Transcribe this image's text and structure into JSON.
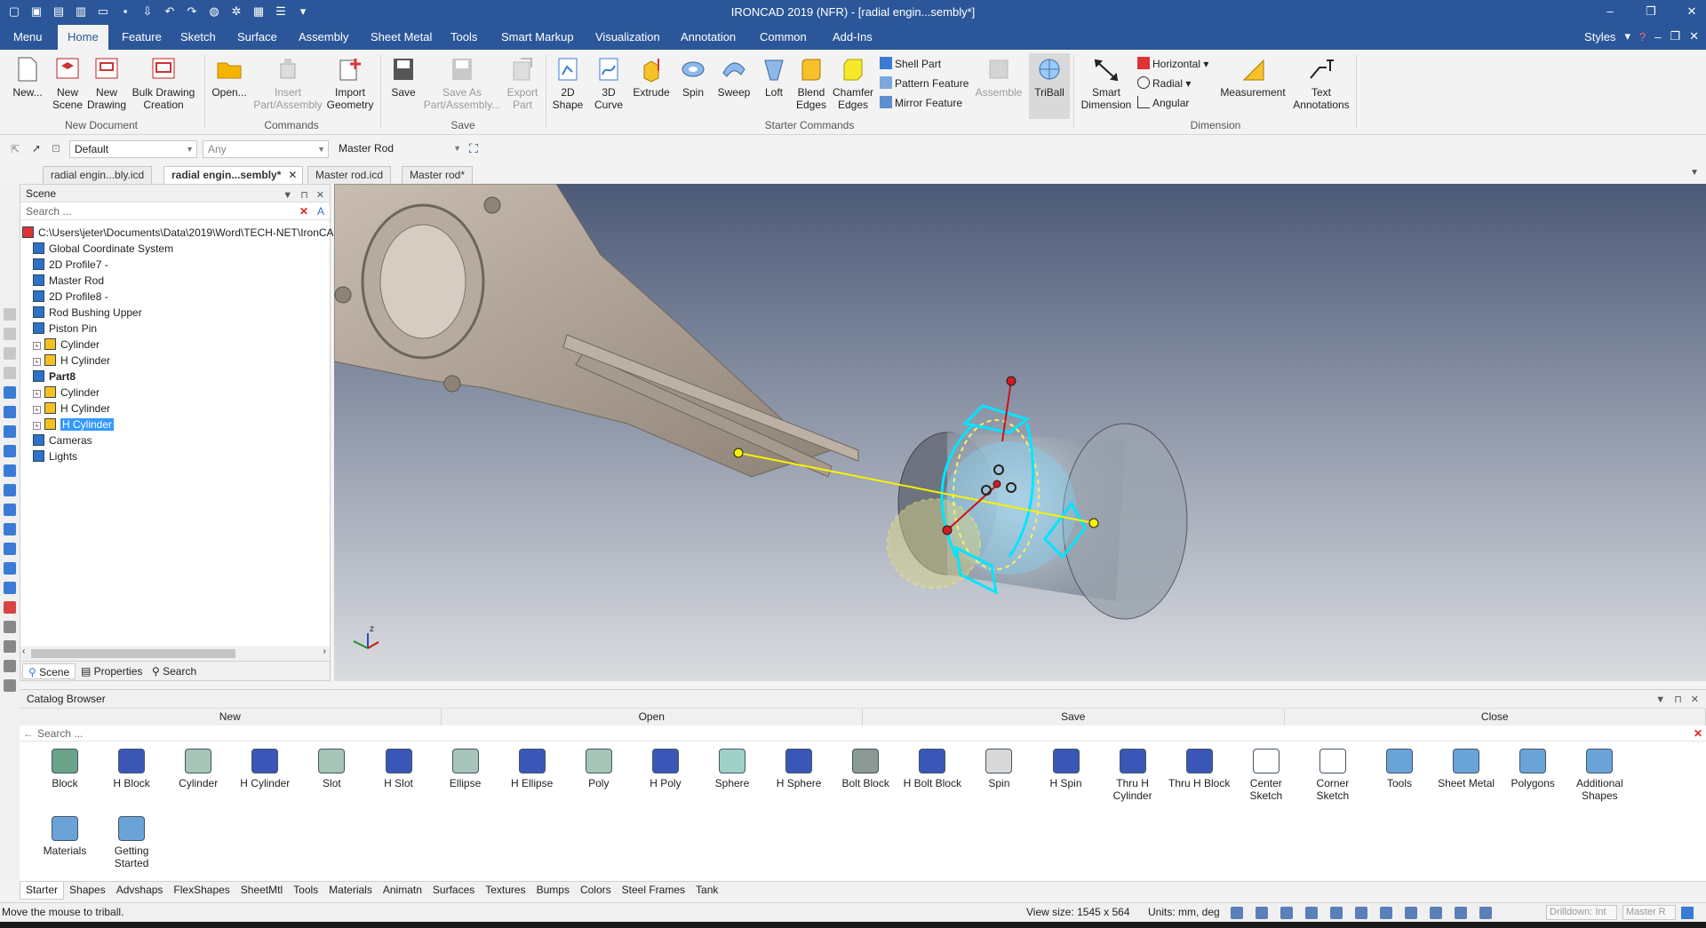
{
  "app": {
    "window_title": "IRONCAD 2019 (NFR) - [radial engin...sembly*]"
  },
  "menu_tabs": [
    "Menu",
    "Home",
    "Feature",
    "Sketch",
    "Surface",
    "Assembly",
    "Sheet Metal",
    "Tools",
    "Smart Markup",
    "Visualization",
    "Annotation",
    "Common",
    "Add-Ins"
  ],
  "styles_label": "Styles",
  "ribbon": {
    "new_document": {
      "group_label": "New Document",
      "buttons": [
        "New...",
        "New Scene",
        "New Drawing",
        "Bulk Drawing Creation"
      ]
    },
    "commands": {
      "group_label": "Commands",
      "buttons": [
        "Open...",
        "Insert Part/Assembly",
        "Import Geometry"
      ]
    },
    "save": {
      "group_label": "Save",
      "buttons": [
        "Save",
        "Save As Part/Assembly...",
        "Export Part"
      ]
    },
    "starter": {
      "group_label": "Starter Commands",
      "buttons": [
        "2D Shape",
        "3D Curve",
        "Extrude",
        "Spin",
        "Sweep",
        "Loft",
        "Blend Edges",
        "Chamfer Edges"
      ],
      "small": [
        "Shell Part",
        "Pattern Feature",
        "Mirror Feature"
      ],
      "extra": [
        "Assemble",
        "TriBall"
      ]
    },
    "dimension": {
      "group_label": "Dimension",
      "smart": "Smart Dimension",
      "small": [
        "Horizontal",
        "Radial",
        "Angular"
      ],
      "measure": "Measurement",
      "text": "Text Annotations"
    }
  },
  "toolbar2": {
    "style_value": "Default",
    "filter_value": "Any",
    "part_value": "Master Rod"
  },
  "doc_tabs": [
    "radial engin...bly.icd",
    "radial engin...sembly*",
    "Master rod.icd",
    "Master rod*"
  ],
  "scene": {
    "header": "Scene",
    "search_placeholder": "Search ...",
    "tree": [
      {
        "label": "C:\\Users\\jeter\\Documents\\Data\\2019\\Word\\TECH-NET\\IronCA",
        "indent": 0
      },
      {
        "label": "Global Coordinate System",
        "indent": 1
      },
      {
        "label": "2D Profile7 -",
        "indent": 1
      },
      {
        "label": "Master Rod",
        "indent": 1
      },
      {
        "label": "2D Profile8 -",
        "indent": 1
      },
      {
        "label": "Rod Bushing Upper",
        "indent": 1
      },
      {
        "label": "Piston Pin",
        "indent": 1
      },
      {
        "label": "Cylinder",
        "indent": 2
      },
      {
        "label": "H Cylinder",
        "indent": 2
      },
      {
        "label": "Part8",
        "indent": 1,
        "bold": true
      },
      {
        "label": "Cylinder",
        "indent": 2
      },
      {
        "label": "H Cylinder",
        "indent": 2
      },
      {
        "label": "H Cylinder",
        "indent": 2,
        "selected": true
      },
      {
        "label": "Cameras",
        "indent": 1
      },
      {
        "label": "Lights",
        "indent": 1
      }
    ],
    "bottom_tabs": [
      "Scene",
      "Properties",
      "Search"
    ]
  },
  "catalog": {
    "header": "Catalog Browser",
    "actions": [
      "New",
      "Open",
      "Save",
      "Close"
    ],
    "search_placeholder": "Search ...",
    "items": [
      "Block",
      "H Block",
      "Cylinder",
      "H Cylinder",
      "Slot",
      "H Slot",
      "Ellipse",
      "H Ellipse",
      "Poly",
      "H Poly",
      "Sphere",
      "H Sphere",
      "Bolt Block",
      "H Bolt Block",
      "Spin",
      "H Spin",
      "Thru H Cylinder",
      "Thru H Block",
      "Center Sketch",
      "Corner Sketch",
      "Tools",
      "Sheet Metal",
      "Polygons",
      "Additional Shapes",
      "Materials",
      "Getting Started"
    ],
    "tabs": [
      "Starter",
      "Shapes",
      "Advshaps",
      "FlexShapes",
      "SheetMtl",
      "Tools",
      "Materials",
      "Animatn",
      "Surfaces",
      "Textures",
      "Bumps",
      "Colors",
      "Steel Frames",
      "Tank"
    ]
  },
  "status": {
    "message": "Move the mouse to triball.",
    "view_size": "View size: 1545 x  564",
    "units": "Units: mm, deg",
    "drilldown": "Drilldown: Int",
    "part": "Master R"
  },
  "colors": {
    "brand": "#2b579a",
    "selection": "#3399ff",
    "triball": "#00e5ff"
  }
}
